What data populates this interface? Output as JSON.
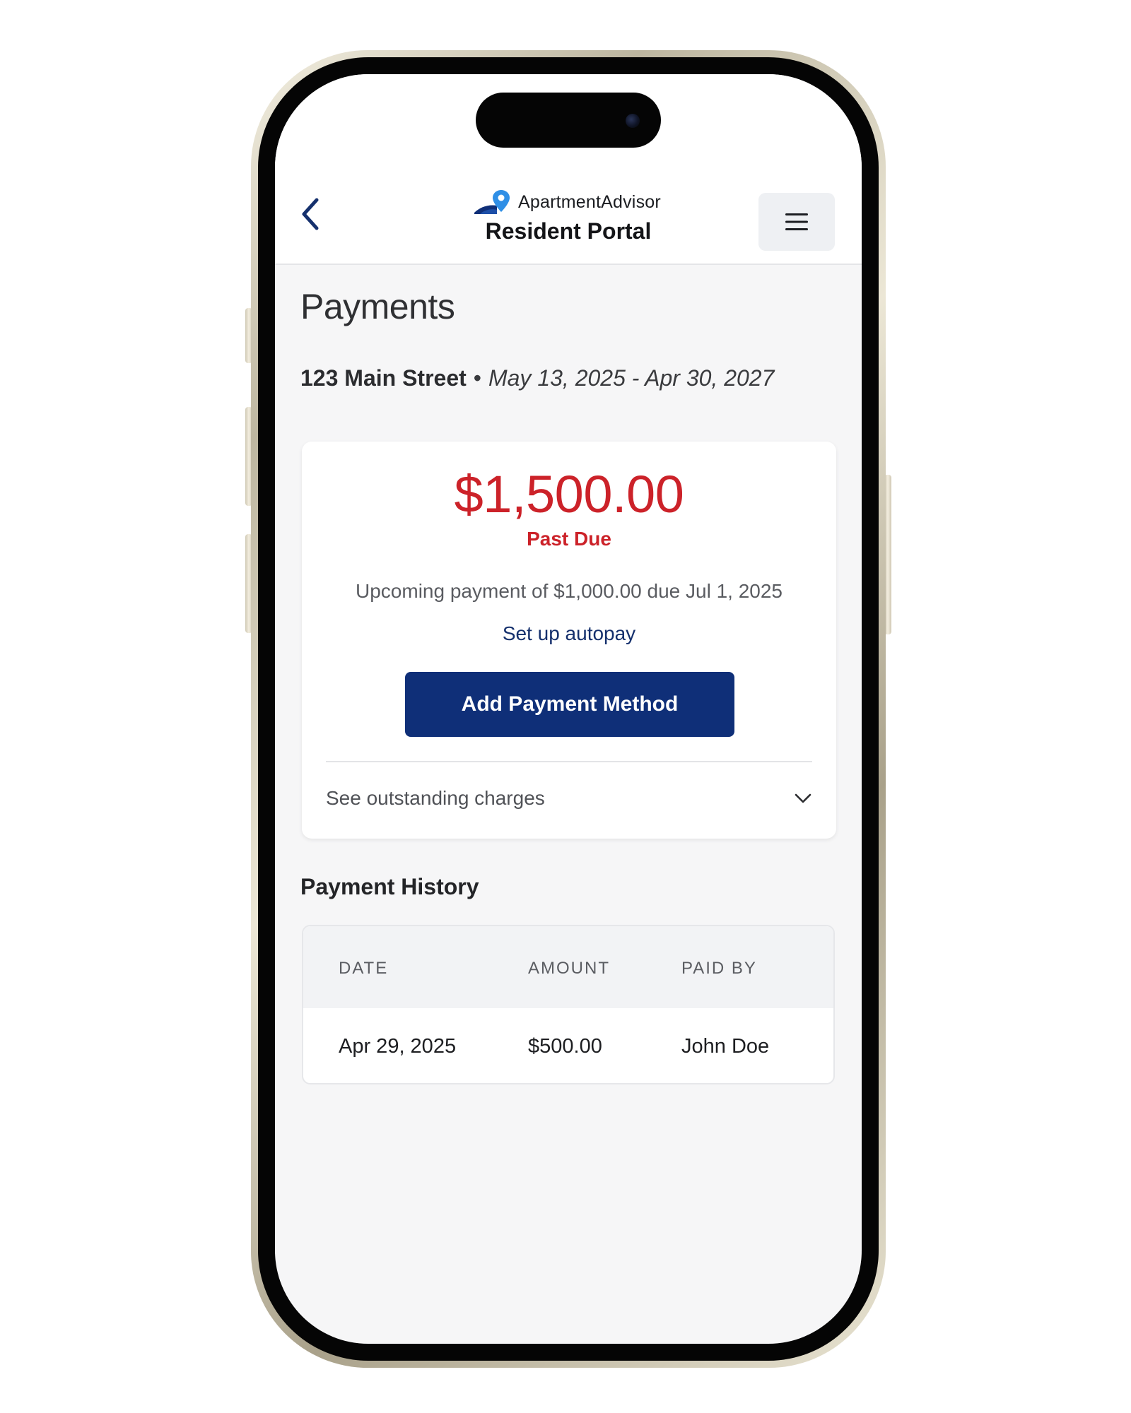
{
  "header": {
    "brand_name": "ApartmentAdvisor",
    "title": "Resident Portal"
  },
  "page": {
    "heading": "Payments",
    "lease": {
      "address": "123 Main Street",
      "separator": "•",
      "dates": "May 13, 2025 - Apr 30, 2027"
    }
  },
  "balance": {
    "amount": "$1,500.00",
    "status": "Past Due",
    "upcoming": "Upcoming payment of $1,000.00 due Jul 1, 2025",
    "autopay_link": "Set up autopay",
    "add_payment_label": "Add Payment Method",
    "outstanding_label": "See outstanding charges"
  },
  "history": {
    "heading": "Payment History",
    "columns": [
      "DATE",
      "AMOUNT",
      "PAID BY"
    ],
    "rows": [
      [
        "Apr 29, 2025",
        "$500.00",
        "John Doe"
      ]
    ]
  },
  "colors": {
    "brand_navy": "#0f2f78",
    "past_due_red": "#cc2229",
    "link_blue": "#15306d",
    "logo_pin_blue": "#2f8fe6"
  },
  "icons": {
    "back": "chevron-left-icon",
    "menu": "hamburger-menu-icon",
    "expand": "chevron-down-icon",
    "logo": "map-pin-roof-icon"
  }
}
